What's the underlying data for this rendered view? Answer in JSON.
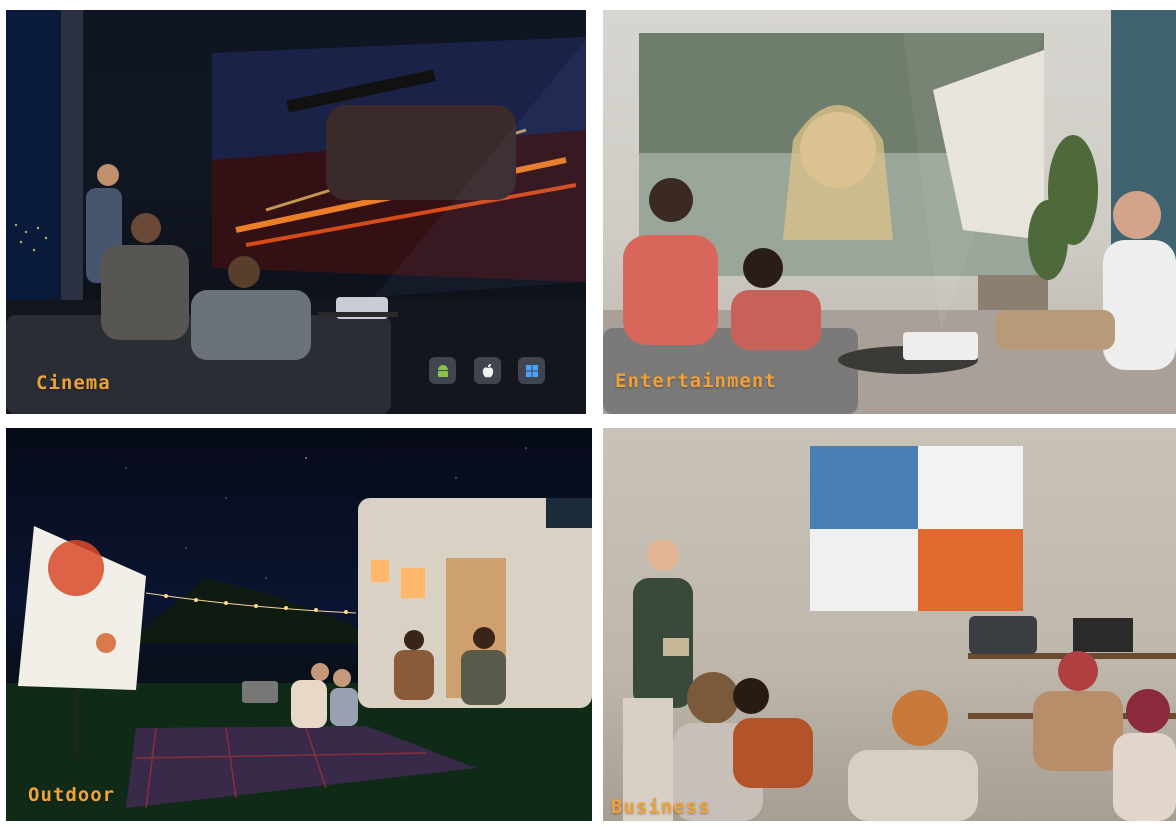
{
  "panels": [
    {
      "label": "Cinema"
    },
    {
      "label": "Entertainment"
    },
    {
      "label": "Outdoor"
    },
    {
      "label": "Business"
    }
  ],
  "icons": {
    "os": [
      "android-icon",
      "apple-icon",
      "windows-icon"
    ]
  },
  "colors": {
    "label": "#f0a23a"
  }
}
